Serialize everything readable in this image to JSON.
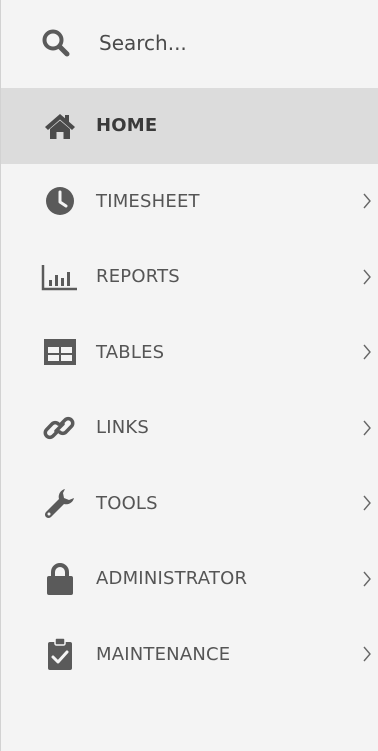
{
  "search": {
    "placeholder": "Search..."
  },
  "nav": {
    "items": [
      {
        "label": "HOME",
        "icon": "home-icon",
        "active": true,
        "has_submenu": false
      },
      {
        "label": "TIMESHEET",
        "icon": "clock-icon",
        "active": false,
        "has_submenu": true
      },
      {
        "label": "REPORTS",
        "icon": "bar-chart-icon",
        "active": false,
        "has_submenu": true
      },
      {
        "label": "TABLES",
        "icon": "table-icon",
        "active": false,
        "has_submenu": true
      },
      {
        "label": "LINKS",
        "icon": "link-icon",
        "active": false,
        "has_submenu": true
      },
      {
        "label": "TOOLS",
        "icon": "wrench-icon",
        "active": false,
        "has_submenu": true
      },
      {
        "label": "ADMINISTRATOR",
        "icon": "lock-icon",
        "active": false,
        "has_submenu": true
      },
      {
        "label": "MAINTENANCE",
        "icon": "clipboard-check-icon",
        "active": false,
        "has_submenu": true
      }
    ]
  },
  "colors": {
    "sidebar_bg": "#f4f4f4",
    "active_bg": "#dcdcdc",
    "icon": "#5a5a5a",
    "text": "#555555"
  }
}
